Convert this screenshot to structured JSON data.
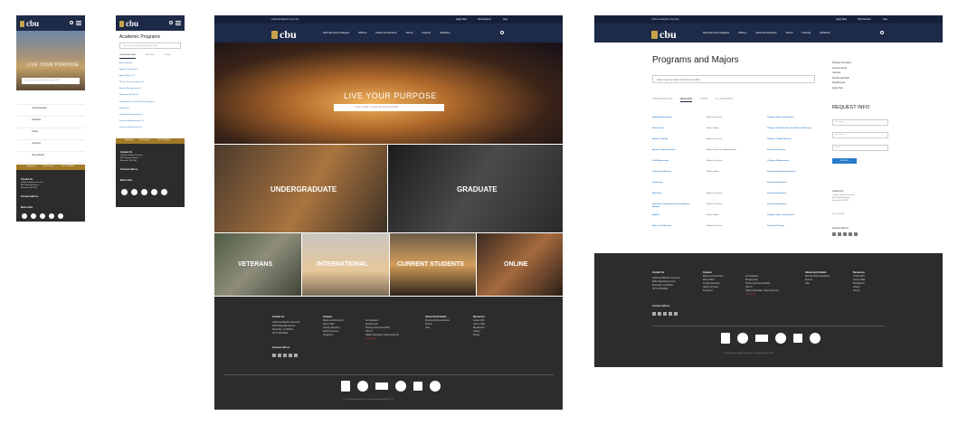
{
  "brand": {
    "logo_text": "cbu",
    "university": "California Baptist University"
  },
  "colors": {
    "navy": "#1d2a48",
    "gold": "#a37a2a",
    "dark_footer": "#2c2c2c",
    "link": "#2a7bc8"
  },
  "top_links": {
    "apply": "Apply Now",
    "visit": "Visit Campus",
    "give": "Give"
  },
  "nav": [
    "Schools and Colleges",
    "Offices",
    "News and Events",
    "About",
    "Faculty",
    "Athletics"
  ],
  "hero": {
    "headline": "LIVE YOUR PURPOSE",
    "search_placeholder": "Type a major or career like Nursing or PhD"
  },
  "tiles": {
    "undergraduate": "UNDERGRADUATE",
    "graduate": "GRADUATE",
    "veterans": "VETERANS",
    "international": "INTERNATIONAL",
    "current": "CURRENT STUDENTS",
    "online": "ONLINE"
  },
  "mobile_menu": [
    "Undergraduate",
    "Graduate",
    "Online",
    "Veterans",
    "International",
    "Current Students"
  ],
  "academic": {
    "title": "Academic Programs",
    "search_placeholder": "Type a major or career like Nursing or PhD",
    "tabs": [
      "UNDERGRADUATE",
      "GRADUATE",
      "ONLINE"
    ],
    "programs": [
      "Accounting (3)",
      "Applied Theology (1)",
      "Applied Music (2)",
      "Ancient Greek Literature (1)",
      "Aviation Management (4)",
      "Behavioral Health (2)",
      "Bioinformatics and Molecular Biology (1)",
      "Biology (5)",
      "Biomedical Engineering (1)",
      "Business Administration (4)",
      "Chemical Engineering (1)"
    ]
  },
  "programs_page": {
    "title": "Programs and Majors",
    "search_placeholder": "Type a major or career like Nursing or PhD",
    "tabs": [
      "UNDERGRADUATE",
      "GRADUATE",
      "ONLINE",
      "ALL PROGRAMS"
    ],
    "rows": [
      [
        "Applied Mathematics",
        "Master of Science",
        "College of Arts and Sciences"
      ],
      [
        "Architecture",
        "Master of Arts",
        "College of Architecture, Visual Arts and Design"
      ],
      [
        "Athletic Training",
        "Master of Science",
        "College of Health Science"
      ],
      [
        "Business Administration",
        "Master of Business Administration",
        "School of Business"
      ],
      [
        "Civil Engineering",
        "Master of Science",
        "College of Engineering"
      ],
      [
        "Counseling Ministry",
        "Master of Arts",
        "School of Behavioral Sciences"
      ],
      [
        "Leadership",
        "",
        "School of Education"
      ],
      [
        "Education",
        "Master of Science",
        "School of Education"
      ],
      [
        "Educational Leadership for Faith-Based Schools",
        "Master of Science",
        "School of Education"
      ],
      [
        "English",
        "Master of Arts",
        "College of Arts and Sciences"
      ],
      [
        "Entry Level Nursing",
        "Master of Science",
        "School of Nursing"
      ]
    ],
    "side_links": [
      "Program Overview",
      "Current Issues",
      "Courses",
      "Faculty and Staff",
      "Departments",
      "Apply Now"
    ],
    "request": {
      "title": "REQUEST INFO",
      "fields": [
        "First Name",
        "Last Name",
        "Email"
      ],
      "submit": "GET INFO"
    }
  },
  "footer": {
    "contact_title": "Contact Us",
    "contact_lines": [
      "California Baptist University",
      "8432 Magnolia Avenue",
      "Riverside, CA 92504",
      "(877) 228-8866"
    ],
    "connect": "Connect with us",
    "more_links": "More Links",
    "columns": [
      {
        "title": "Campus",
        "items": [
          "Maps and Directions",
          "About CBU",
          "Faculty Directory",
          "Safety Services",
          "Programs"
        ]
      },
      {
        "title": "",
        "items": [
          "Accreditation",
          "Employment",
          "Privacy and Accessibility",
          "Title IX",
          "Higher Education Opportunity Act",
          "A-Z Index"
        ]
      },
      {
        "title": "Alumni and Friends",
        "items": [
          "Membership Association",
          "Events",
          "Give"
        ]
      },
      {
        "title": "Resources",
        "items": [
          "Inside CBU",
          "Lancer Mail",
          "Blackboard",
          "Library",
          "Dining"
        ]
      }
    ],
    "copyright": "© 2024 California Baptist University. Last modified April 8, 2019."
  }
}
